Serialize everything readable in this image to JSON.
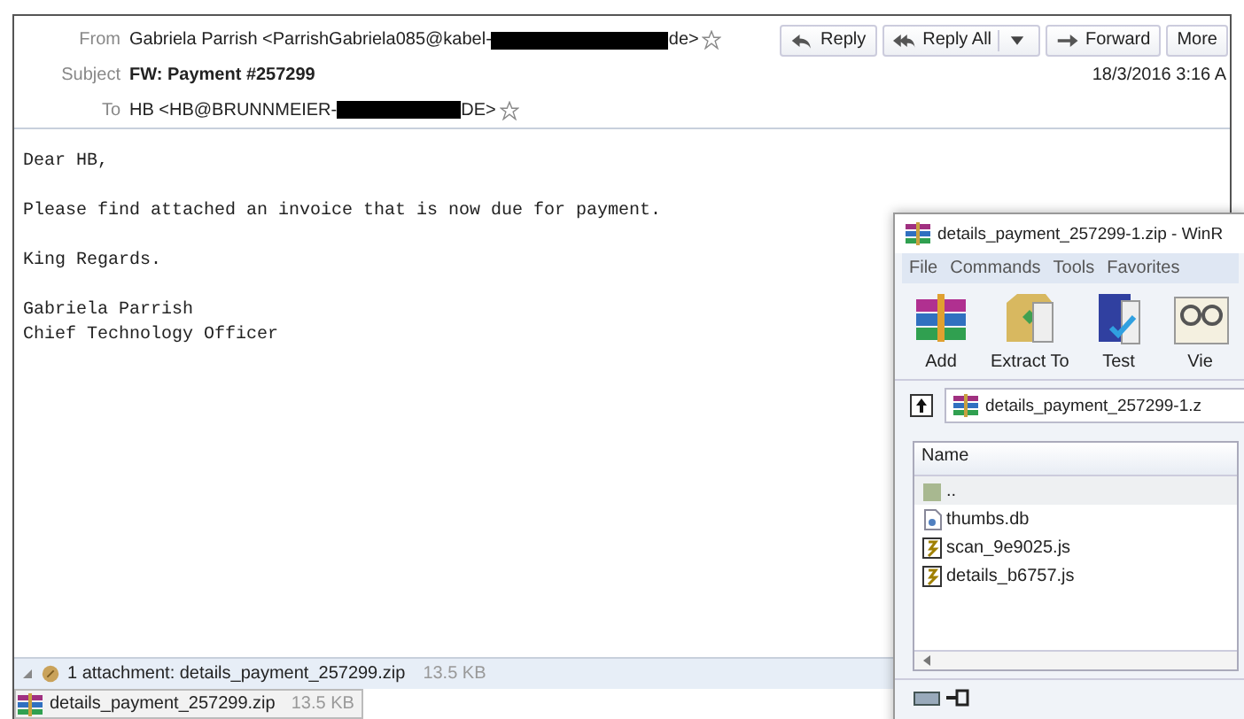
{
  "header": {
    "from_label": "From",
    "from": "Gabriela Parrish <ParrishGabriela085@kabel-",
    "from_end": "de>",
    "subject_label": "Subject",
    "subject": "FW: Payment #257299",
    "to_label": "To",
    "to": "HB <HB@BRUNNMEIER-",
    "to_end": "DE>",
    "date": "18/3/2016 3:16 A"
  },
  "actions": [
    {
      "label": "Reply",
      "kind": "reply"
    },
    {
      "label": "Reply All",
      "kind": "reply-all"
    },
    {
      "label": "Forward",
      "kind": "forward"
    },
    {
      "label": "More",
      "kind": "more"
    }
  ],
  "body": [
    [
      "Dear HB,"
    ],
    [
      "Please find attached an invoice that is now due for payment."
    ],
    [
      "King Regards."
    ],
    [
      "Gabriela Parrish",
      "Chief Technology Officer"
    ]
  ],
  "attachment_bar": {
    "summary": "1 attachment: details_payment_257299.zip",
    "size": "13.5 KB"
  },
  "attachments": [
    {
      "name": "details_payment_257299.zip",
      "size": "13.5 KB"
    }
  ],
  "winrar": {
    "title": "details_payment_257299-1.zip - WinR",
    "menu": [
      "File",
      "Commands",
      "Tools",
      "Favorites"
    ],
    "tools": [
      {
        "label": "Add",
        "kind": "add"
      },
      {
        "label": "Extract To",
        "kind": "extract"
      },
      {
        "label": "Test",
        "kind": "test"
      },
      {
        "label": "Vie",
        "kind": "view"
      }
    ],
    "path": "details_payment_257299-1.z",
    "column": "Name",
    "files": [
      {
        "name": "..",
        "kind": "folder",
        "selected": true
      },
      {
        "name": "thumbs.db",
        "kind": "db",
        "selected": false
      },
      {
        "name": "scan_9e9025.js",
        "kind": "script",
        "selected": false
      },
      {
        "name": "details_b6757.js",
        "kind": "script",
        "selected": false
      }
    ]
  }
}
